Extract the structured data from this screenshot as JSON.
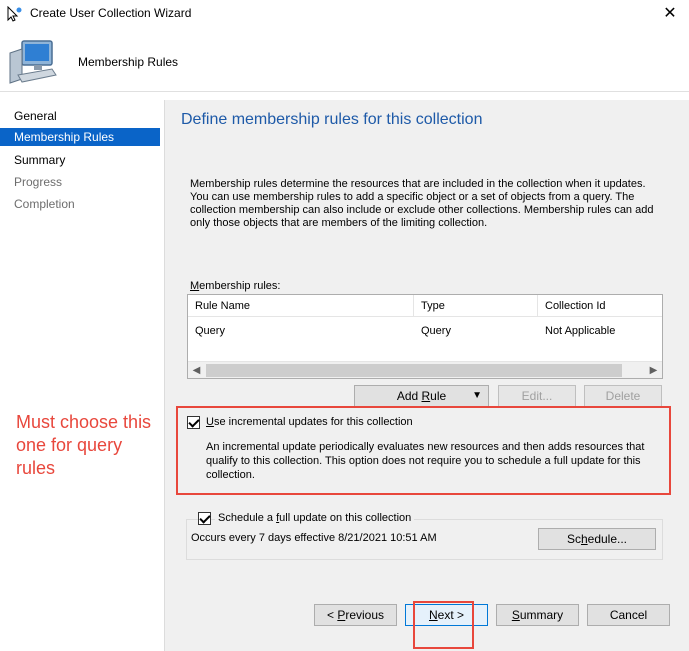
{
  "window": {
    "title": "Create User Collection Wizard",
    "close_glyph": "✕"
  },
  "banner": {
    "title": "Membership Rules"
  },
  "sidebar": {
    "items": [
      {
        "label": "General"
      },
      {
        "label": "Membership Rules"
      },
      {
        "label": "Summary"
      },
      {
        "label": "Progress"
      },
      {
        "label": "Completion"
      }
    ]
  },
  "content": {
    "heading": "Define membership rules for this collection",
    "description": "Membership rules determine the resources that are included in the collection when it updates. You can use membership rules to add a specific object or a set of objects from a query. The collection membership can also include or exclude other collections. Membership rules can add only those objects that are members of the limiting collection.",
    "rules_label_pre": "",
    "rules_label_accel": "M",
    "rules_label_post": "embership rules:",
    "table": {
      "columns": [
        "Rule Name",
        "Type",
        "Collection Id"
      ],
      "rows": [
        [
          "Query",
          "Query",
          "Not Applicable"
        ]
      ]
    },
    "buttons": {
      "add_rule_pre": "Add ",
      "add_rule_accel": "R",
      "add_rule_post": "ule",
      "edit": "Edit...",
      "delete": "Delete"
    },
    "incremental": {
      "checked": true,
      "label_pre": "",
      "label_accel": "U",
      "label_post": "se incremental updates for this collection",
      "description": "An incremental update periodically evaluates new resources and then adds resources that qualify to this collection. This option does not require you to schedule a full update for this collection."
    },
    "full_update": {
      "checked": true,
      "label_pre": "Schedule a ",
      "label_accel": "f",
      "label_post": "ull update on this collection",
      "schedule_text": "Occurs every 7 days effective 8/21/2021 10:51 AM",
      "schedule_btn_pre": "Sc",
      "schedule_btn_accel": "h",
      "schedule_btn_post": "edule..."
    }
  },
  "footer": {
    "previous_pre": "< ",
    "previous_accel": "P",
    "previous_post": "revious",
    "next_pre": "",
    "next_accel": "N",
    "next_post": "ext >",
    "summary_pre": "",
    "summary_accel": "S",
    "summary_post": "ummary",
    "cancel": "Cancel"
  },
  "annotation": {
    "text": "Must choose this one for query rules",
    "color": "#e8473c"
  },
  "colors": {
    "selection": "#0a64c8",
    "heading": "#1e5aa8"
  }
}
